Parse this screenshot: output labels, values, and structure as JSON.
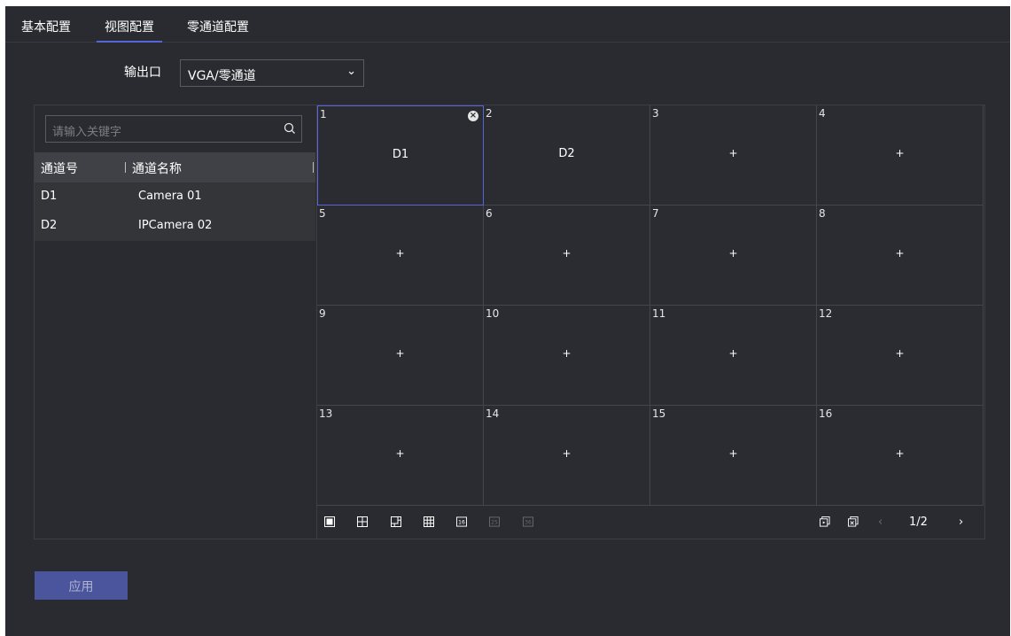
{
  "tabs": [
    {
      "label": "基本配置"
    },
    {
      "label": "视图配置",
      "active": true
    },
    {
      "label": "零通道配置"
    }
  ],
  "output": {
    "label": "输出口",
    "value": "VGA/零通道"
  },
  "search": {
    "placeholder": "请输入关键字",
    "icon": "search-icon"
  },
  "channel_table": {
    "columns": [
      "通道号",
      "通道名称"
    ],
    "rows": [
      {
        "id": "D1",
        "name": "Camera 01"
      },
      {
        "id": "D2",
        "name": "IPCamera 02"
      }
    ]
  },
  "view_grid": {
    "cells": [
      {
        "num": "1",
        "content": "D1"
      },
      {
        "num": "2",
        "content": "D2"
      },
      {
        "num": "3",
        "content": "+"
      },
      {
        "num": "4",
        "content": "+"
      },
      {
        "num": "5",
        "content": "+"
      },
      {
        "num": "6",
        "content": "+"
      },
      {
        "num": "7",
        "content": "+"
      },
      {
        "num": "8",
        "content": "+"
      },
      {
        "num": "9",
        "content": "+"
      },
      {
        "num": "10",
        "content": "+"
      },
      {
        "num": "11",
        "content": "+"
      },
      {
        "num": "12",
        "content": "+"
      },
      {
        "num": "13",
        "content": "+"
      },
      {
        "num": "14",
        "content": "+"
      },
      {
        "num": "15",
        "content": "+"
      },
      {
        "num": "16",
        "content": "+"
      }
    ]
  },
  "toolbar": {
    "layout_icons": [
      "layout-1-icon",
      "layout-4-icon",
      "layout-6-icon",
      "layout-9-icon",
      "layout-16-icon",
      "layout-25-icon",
      "layout-36-icon"
    ],
    "layout_labels": {
      "l16": "16",
      "l25": "25",
      "l36": "36"
    },
    "page_indicator": "1/2"
  },
  "apply_label": "应用",
  "colors": {
    "accent": "#5567d8",
    "background": "#2a2b30",
    "apply_button": "#4a559e"
  }
}
